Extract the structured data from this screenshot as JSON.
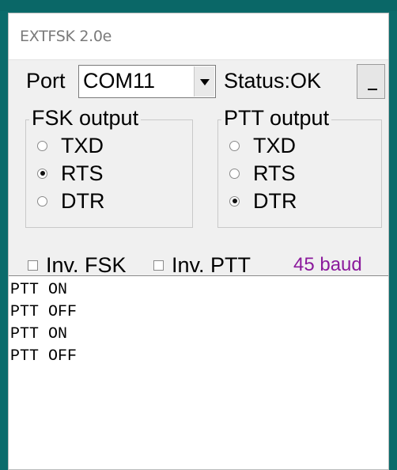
{
  "window": {
    "title": "EXTFSK 2.0e"
  },
  "port": {
    "label": "Port",
    "value": "COM11"
  },
  "status": {
    "text": "Status:OK"
  },
  "minimize": {
    "label": "_"
  },
  "fsk_group": {
    "title": "FSK output",
    "options": [
      {
        "label": "TXD",
        "checked": false
      },
      {
        "label": "RTS",
        "checked": true
      },
      {
        "label": "DTR",
        "checked": false
      }
    ]
  },
  "ptt_group": {
    "title": "PTT output",
    "options": [
      {
        "label": "TXD",
        "checked": false
      },
      {
        "label": "RTS",
        "checked": false
      },
      {
        "label": "DTR",
        "checked": true
      }
    ]
  },
  "inv_fsk": {
    "label": "Inv. FSK",
    "checked": false
  },
  "inv_ptt": {
    "label": "Inv. PTT",
    "checked": false
  },
  "baud": {
    "text": "45 baud",
    "color": "#8b1a9c"
  },
  "log": {
    "lines": [
      "PTT ON",
      "PTT OFF",
      "PTT ON",
      "PTT OFF"
    ]
  }
}
